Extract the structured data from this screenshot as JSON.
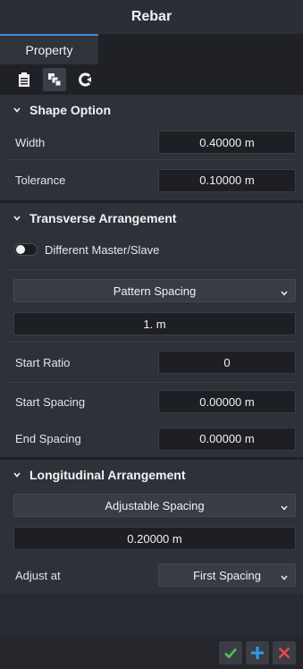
{
  "window": {
    "title": "Rebar"
  },
  "tabs": [
    {
      "label": "Property"
    }
  ],
  "toolbar": {
    "icons": [
      "clipboard-icon",
      "layers-icon",
      "refresh-icon"
    ]
  },
  "shape_option": {
    "title": "Shape Option",
    "width": {
      "label": "Width",
      "value": "0.40000 m"
    },
    "tolerance": {
      "label": "Tolerance",
      "value": "0.10000 m"
    }
  },
  "transverse": {
    "title": "Transverse Arrangement",
    "toggle_label": "Different Master/Slave",
    "toggle_on": false,
    "pattern": {
      "value": "Pattern Spacing"
    },
    "pattern_value": "1. m",
    "start_ratio": {
      "label": "Start Ratio",
      "value": "0"
    },
    "start_spacing": {
      "label": "Start Spacing",
      "value": "0.00000 m"
    },
    "end_spacing": {
      "label": "End Spacing",
      "value": "0.00000 m"
    }
  },
  "longitudinal": {
    "title": "Longitudinal Arrangement",
    "spacing_type": {
      "value": "Adjustable Spacing"
    },
    "spacing_value": "0.20000 m",
    "adjust_at": {
      "label": "Adjust at",
      "value": "First Spacing"
    }
  },
  "colors": {
    "accent": "#3f8fd6",
    "ok": "#4cc34a",
    "add": "#2f9be6",
    "cancel": "#e5484d"
  }
}
